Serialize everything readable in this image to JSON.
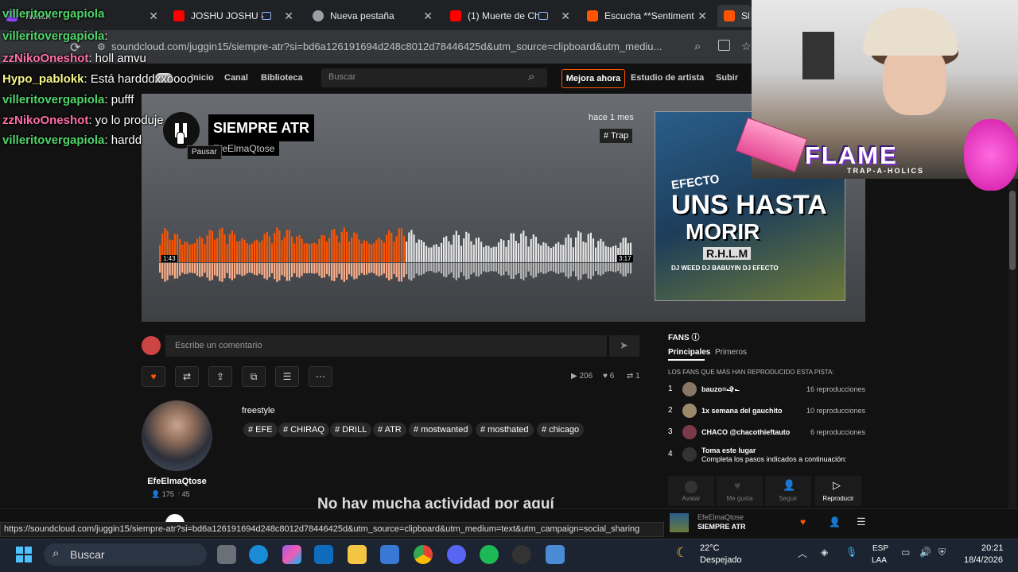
{
  "browser": {
    "tabs": [
      {
        "label": "Twitch",
        "color": "#9146ff"
      },
      {
        "label": "JOSHU JOSHU -",
        "color": "#ff0000"
      },
      {
        "label": "Nueva pestaña",
        "color": "#9aa0a6"
      },
      {
        "label": "(1) Muerte de Ch",
        "color": "#ff0000"
      },
      {
        "label": "Escucha **Sentiment",
        "color": "#ff5500"
      },
      {
        "label": "Sl",
        "color": "#ff5500"
      }
    ],
    "url": "soundcloud.com/juggin15/siempre-atr?si=bd6a126191694d248c8012d78446425d&utm_source=clipboard&utm_mediu...",
    "status_url": "https://soundcloud.com/juggin15/siempre-atr?si=bd6a126191694d248c8012d78446425d&utm_source=clipboard&utm_medium=text&utm_campaign=social_sharing"
  },
  "sc_header": {
    "nav": [
      "Inicio",
      "Canal",
      "Biblioteca"
    ],
    "search_placeholder": "Buscar",
    "upgrade": "Mejora ahora",
    "artist_studio": "Estudio de artista",
    "upload": "Subir"
  },
  "track": {
    "title": "SIEMPRE ATR",
    "artist": "EfeElmaQtose",
    "tooltip": "Pausar",
    "posted": "hace 1 mes",
    "genre": "# Trap",
    "elapsed": "1:43",
    "duration": "3:17",
    "progress": 0.52
  },
  "cover": {
    "line1": "EFECTO",
    "line2": "UNS HASTA",
    "line3": "MORIR",
    "line4": "R.H.L.M",
    "credits": "DJ WEED DJ BABUYIN DJ EFECTO"
  },
  "comment": {
    "placeholder": "Escribe un comentario"
  },
  "stats": {
    "plays": "206",
    "likes": "6",
    "reposts": "1"
  },
  "uploader": {
    "name": "EfeElmaQtose",
    "followers": "175",
    "tracks": "45"
  },
  "description": "freestyle",
  "tags": [
    "# EFE",
    "# CHIRAQ",
    "# DRILL",
    "# ATR",
    "# mostwanted",
    "# mosthated",
    "# chicago"
  ],
  "no_activity": "No hay mucha actividad por aquí",
  "fans": {
    "title": "FANS",
    "tab_top": "Principales",
    "tab_first": "Primeros",
    "subtitle": "LOS FANS QUE MÁS HAN REPRODUCIDO ESTA PISTA:",
    "list": [
      {
        "rank": "1",
        "name": "bauzo=-̶̶̶̶̶̶✞-̶̶̶̶̶̶",
        "count": "16 reproducciones"
      },
      {
        "rank": "2",
        "name": "1x semana del gauchito",
        "count": "10 reproducciones"
      },
      {
        "rank": "3",
        "name": "CHACO @chacothieftauto",
        "count": "6 reproducciones"
      }
    ],
    "placeholder_rank": "4",
    "placeholder_name": "Toma este lugar",
    "placeholder_sub": "Completa los pasos indicados a continuación:",
    "steps": [
      "Avatar",
      "Me gusta",
      "Seguir",
      "Reproducir"
    ]
  },
  "player": {
    "artist": "EfeElmaQtose",
    "track": "SIEMPRE ATR"
  },
  "chat": [
    {
      "user": "villeritovergapiola",
      "msg": "",
      "color": "#4fd66a"
    },
    {
      "user": "villeritovergapiola",
      "msg": ":",
      "color": "#4fd66a"
    },
    {
      "user": "zzNikoOneshot",
      "msg": ": holl amvu",
      "color": "#ff6fa8"
    },
    {
      "user": "Hypo_pablokk",
      "msg": ": Está hardddxxoooo",
      "color": "#f5f58a"
    },
    {
      "user": "villeritovergapiola",
      "msg": ": pufff",
      "color": "#4fd66a"
    },
    {
      "user": "zzNikoOneshot",
      "msg": ": yo lo produje",
      "color": "#ff6fa8"
    },
    {
      "user": "villeritovergapiola",
      "msg": ": hardd",
      "color": "#4fd66a"
    }
  ],
  "overlay": {
    "brand": "FLAME",
    "brand_sub": "TRAP-A-HOLICS"
  },
  "taskbar": {
    "search": "Buscar",
    "weather_temp": "22°C",
    "weather_desc": "Despejado",
    "lang": "ESP",
    "layout": "LAA",
    "time": "20:21",
    "date": "18/4/2026"
  }
}
